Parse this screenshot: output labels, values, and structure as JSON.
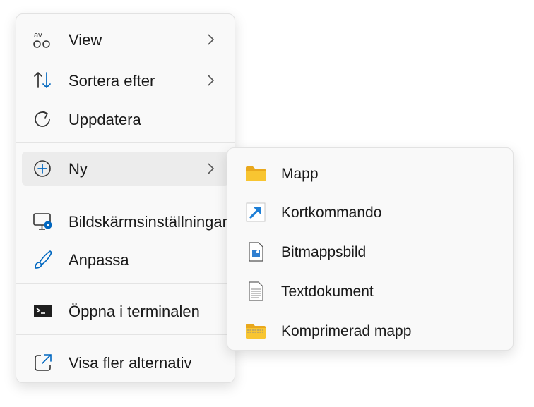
{
  "context_menu": {
    "items": [
      {
        "label": "View",
        "icon": "view-icon",
        "has_submenu": true
      },
      {
        "label": "Sortera efter",
        "icon": "sort-arrows-icon",
        "has_submenu": true
      },
      {
        "label": "Uppdatera",
        "icon": "refresh-icon",
        "has_submenu": false
      },
      {
        "label": "Ny",
        "icon": "add-circle-icon",
        "has_submenu": true
      },
      {
        "label": "Bildskärmsinställningar",
        "icon": "display-settings-icon",
        "has_submenu": false
      },
      {
        "label": "Anpassa",
        "icon": "brush-icon",
        "has_submenu": false
      },
      {
        "label": "Öppna i terminalen",
        "icon": "terminal-icon",
        "has_submenu": false
      },
      {
        "label": "Visa fler alternativ",
        "icon": "open-external-icon",
        "has_submenu": false
      }
    ]
  },
  "new_submenu": {
    "items": [
      {
        "label": "Mapp",
        "icon": "folder-icon"
      },
      {
        "label": "Kortkommando",
        "icon": "shortcut-icon"
      },
      {
        "label": "Bitmappsbild",
        "icon": "bitmap-image-icon"
      },
      {
        "label": "Textdokument",
        "icon": "text-document-icon"
      },
      {
        "label": "Komprimerad mapp",
        "icon": "zip-folder-icon"
      }
    ]
  },
  "colors": {
    "accent": "#0067c0",
    "folder": "#f8c531",
    "menu_background": "#f9f9f9",
    "hover_background": "#ececec"
  }
}
